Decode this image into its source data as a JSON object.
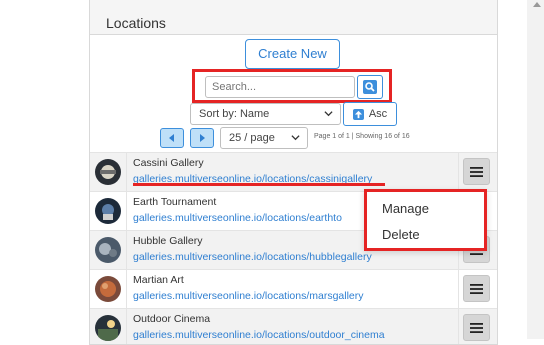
{
  "panel": {
    "title": "Locations"
  },
  "toolbar": {
    "create_label": "Create New",
    "search_placeholder": "Search...",
    "sort_label": "Sort by: Name",
    "asc_label": "Asc",
    "per_page": "25 / page",
    "page_info": "Page 1 of 1 | Showing 16 of 16"
  },
  "locations": [
    {
      "name": "Cassini Gallery",
      "url": "galleries.multiverseonline.io/locations/cassinigallery"
    },
    {
      "name": "Earth Tournament",
      "url": "galleries.multiverseonline.io/locations/earthto"
    },
    {
      "name": "Hubble Gallery",
      "url": "galleries.multiverseonline.io/locations/hubblegallery"
    },
    {
      "name": "Martian Art",
      "url": "galleries.multiverseonline.io/locations/marsgallery"
    },
    {
      "name": "Outdoor Cinema",
      "url": "galleries.multiverseonline.io/locations/outdoor_cinema"
    }
  ],
  "context_menu": {
    "manage": "Manage",
    "delete": "Delete"
  },
  "icons": {
    "search": "search-icon",
    "menu": "hamburger-icon",
    "prev": "prev-page-icon",
    "next": "next-page-icon",
    "sort": "sort-asc-icon"
  },
  "colors": {
    "accent": "#3d8fdc",
    "highlight": "#e52424",
    "link": "#2f7fd1"
  }
}
